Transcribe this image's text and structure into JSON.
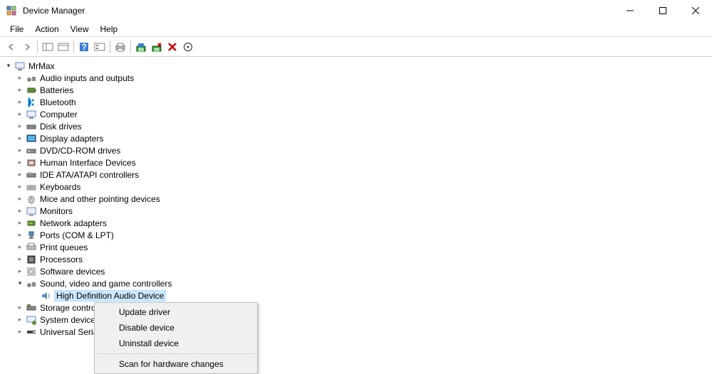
{
  "window": {
    "title": "Device Manager"
  },
  "menubar": {
    "items": [
      "File",
      "Action",
      "View",
      "Help"
    ]
  },
  "tree": {
    "root": "MrMax",
    "categories": [
      "Audio inputs and outputs",
      "Batteries",
      "Bluetooth",
      "Computer",
      "Disk drives",
      "Display adapters",
      "DVD/CD-ROM drives",
      "Human Interface Devices",
      "IDE ATA/ATAPI controllers",
      "Keyboards",
      "Mice and other pointing devices",
      "Monitors",
      "Network adapters",
      "Ports (COM & LPT)",
      "Print queues",
      "Processors",
      "Software devices",
      "Sound, video and game controllers",
      "Storage contro",
      "System device",
      "Universal Seria"
    ],
    "selected_device": "High Definition Audio Device"
  },
  "context_menu": {
    "items": [
      "Update driver",
      "Disable device",
      "Uninstall device",
      "Scan for hardware changes"
    ]
  }
}
